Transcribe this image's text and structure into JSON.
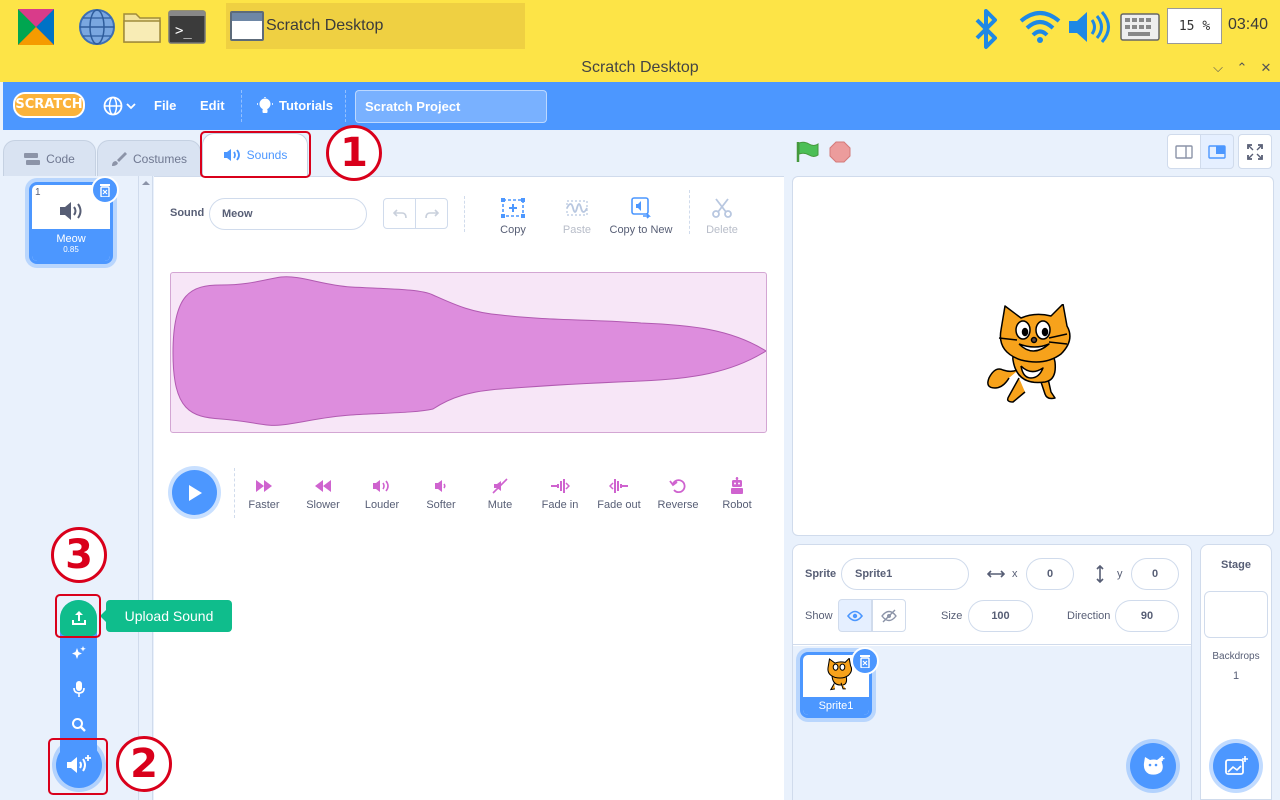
{
  "taskbar": {
    "window_title": "Scratch Desktop",
    "cpu_usage": "15 %",
    "clock": "03:40"
  },
  "window": {
    "title": "Scratch Desktop"
  },
  "menubar": {
    "logo_text": "SCRATCH",
    "file": "File",
    "edit": "Edit",
    "tutorials": "Tutorials",
    "project_title": "Scratch Project"
  },
  "tabs": {
    "code": "Code",
    "costumes": "Costumes",
    "sounds": "Sounds"
  },
  "callouts": {
    "one": "1",
    "two": "2",
    "three": "3"
  },
  "sound_list": [
    {
      "index": "1",
      "name": "Meow",
      "duration": "0.85"
    }
  ],
  "sound_menu": {
    "tooltip": "Upload Sound"
  },
  "editor": {
    "sound_label": "Sound",
    "sound_name": "Meow",
    "tools": {
      "copy": "Copy",
      "paste": "Paste",
      "copy_to_new": "Copy to New",
      "delete": "Delete"
    },
    "effects": [
      "Faster",
      "Slower",
      "Louder",
      "Softer",
      "Mute",
      "Fade in",
      "Fade out",
      "Reverse",
      "Robot"
    ]
  },
  "sprite_info": {
    "sprite_label": "Sprite",
    "sprite_name": "Sprite1",
    "x_label": "x",
    "x_value": "0",
    "y_label": "y",
    "y_value": "0",
    "show_label": "Show",
    "size_label": "Size",
    "size_value": "100",
    "direction_label": "Direction",
    "direction_value": "90"
  },
  "sprites": [
    {
      "name": "Sprite1"
    }
  ],
  "stage_pane": {
    "title": "Stage",
    "backdrops_label": "Backdrops",
    "backdrops_count": "1"
  },
  "colors": {
    "scratch_blue": "#4c97ff",
    "upload_green": "#0fbd8c",
    "taskbar_yellow": "#fde447",
    "annotation_red": "#d9001b",
    "waveform_fill": "#dd8ddd"
  }
}
